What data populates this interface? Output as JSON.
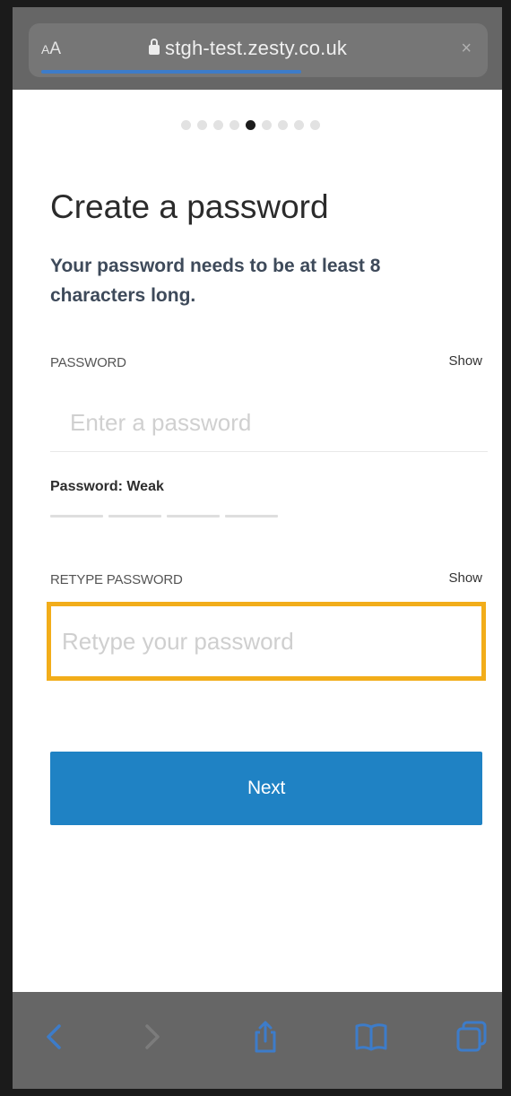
{
  "browser": {
    "text_size_label": "AA",
    "url": "stgh-test.zesty.co.uk",
    "load_progress": 0.6,
    "close_label": "×"
  },
  "stepper": {
    "total_steps": 9,
    "current_step": 5
  },
  "page": {
    "title": "Create a password",
    "subtitle": "Your password needs to be at least 8 characters long."
  },
  "password_field": {
    "label": "PASSWORD",
    "show_label": "Show",
    "placeholder": "Enter a password",
    "value": ""
  },
  "strength": {
    "label": "Password: Weak",
    "level": 0,
    "segments": 4
  },
  "retype_field": {
    "label": "RETYPE PASSWORD",
    "show_label": "Show",
    "placeholder": "Retype your password",
    "value": "",
    "focused": true
  },
  "next_button": {
    "label": "Next"
  },
  "toolbar": {
    "icons": [
      "back-icon",
      "forward-icon",
      "share-icon",
      "bookmarks-icon",
      "tabs-icon"
    ]
  },
  "colors": {
    "accent": "#1f82c4",
    "focus": "#f2ad1a",
    "chrome": "#666666"
  }
}
